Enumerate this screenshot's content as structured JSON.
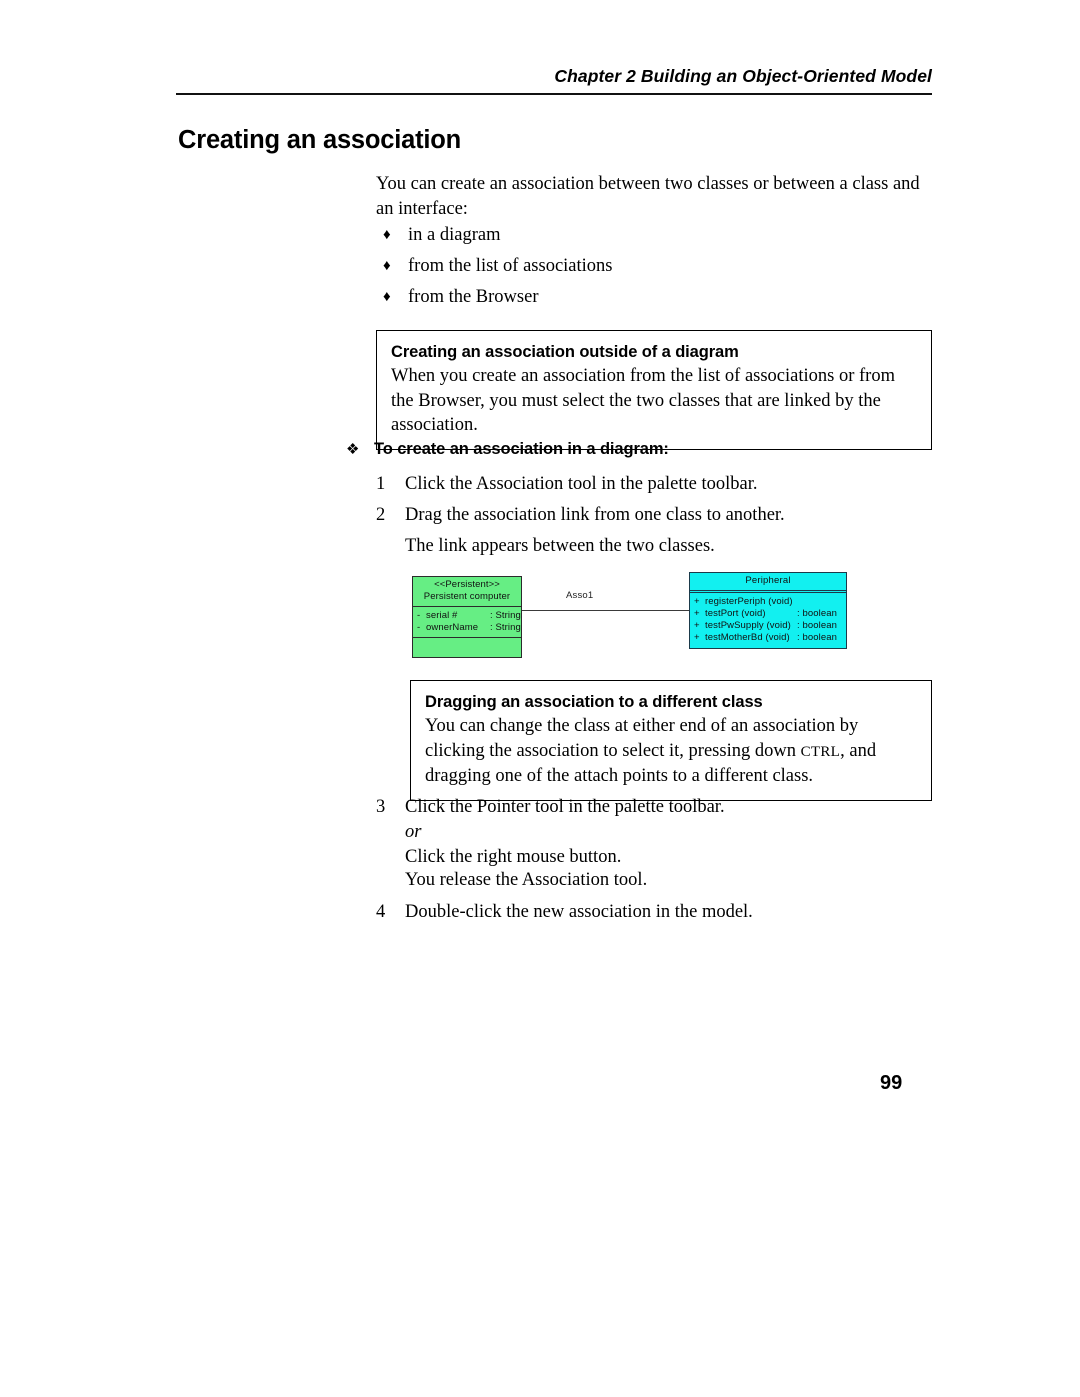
{
  "header": {
    "running_head": "Chapter 2  Building an Object-Oriented Model"
  },
  "section": {
    "title": "Creating an association",
    "intro": "You can create an association between two classes or between a class and an interface:"
  },
  "bullets": {
    "marker": "♦",
    "items": [
      {
        "label": "in a diagram"
      },
      {
        "label": "from the list of associations"
      },
      {
        "label": "from the Browser"
      }
    ]
  },
  "note_outside": {
    "title": "Creating an association outside of a diagram",
    "body": "When you create an association from the list of associations or from the Browser, you must select the two classes that are linked by the association."
  },
  "procedure": {
    "marker": "❖",
    "heading": "To create an association in a diagram:",
    "steps": [
      {
        "num": "1",
        "text": "Click the Association tool in the palette toolbar."
      },
      {
        "num": "2",
        "text": "Drag the association link from one class to another."
      }
    ],
    "step2_note": "The link appears between the two classes.",
    "step3": {
      "num": "3",
      "text": "Click the Pointer tool in the palette toolbar.",
      "or": "or",
      "alt_text": "Click the right mouse button."
    },
    "step3_note": "You release the Association tool.",
    "step4": {
      "num": "4",
      "text": "Double-click the new association in the model."
    }
  },
  "note_dragging": {
    "title": "Dragging an association to a different class",
    "body_part1": "You can change the class at either end of an association by clicking the association to select it, pressing down ",
    "ctrl": "CTRL",
    "body_part2": ", and dragging one of the attach points to a different class."
  },
  "diagram": {
    "association_label": "Asso1",
    "colors": {
      "persistent_fill": "#66ee84",
      "peripheral_fill": "#12f0f0",
      "border": "#2b2b2b",
      "link": "#3a3a3a"
    },
    "persistent_class": {
      "stereotype": "<<Persistent>>",
      "name": "Persistent computer",
      "attributes": [
        {
          "visibility": "-",
          "name": "serial #",
          "type": ": String"
        },
        {
          "visibility": "-",
          "name": "ownerName",
          "type": ": String"
        }
      ]
    },
    "peripheral_class": {
      "name": "Peripheral",
      "operations": [
        {
          "visibility": "+",
          "name": "registerPeriph (void)",
          "type": ""
        },
        {
          "visibility": "+",
          "name": "testPort (void)",
          "type": ": boolean"
        },
        {
          "visibility": "+",
          "name": "testPwSupply (void)",
          "type": ": boolean"
        },
        {
          "visibility": "+",
          "name": "testMotherBd (void)",
          "type": ": boolean"
        }
      ]
    }
  },
  "footer": {
    "page_number": "99"
  }
}
